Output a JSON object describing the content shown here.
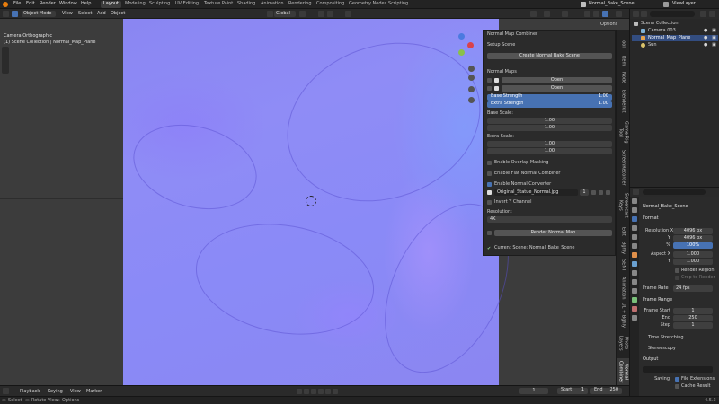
{
  "menu": {
    "items": [
      "File",
      "Edit",
      "Render",
      "Window",
      "Help"
    ],
    "workspaces": [
      "Layout",
      "Modeling",
      "Sculpting",
      "UV Editing",
      "Texture Paint",
      "Shading",
      "Animation",
      "Rendering",
      "Compositing",
      "Geometry Nodes",
      "Scripting"
    ],
    "active_workspace": "Layout",
    "scene": "Normal_Bake_Scene",
    "view_layer": "ViewLayer"
  },
  "editor_header": {
    "mode": "Object Mode",
    "menus": [
      "View",
      "Select",
      "Add",
      "Object"
    ],
    "orientation": "Global",
    "options": "Options"
  },
  "viewport": {
    "camera_label": "Camera Orthographic",
    "collection_label": "(1) Scene Collection | Normal_Map_Plane"
  },
  "panel": {
    "title": "Normal Map Combiner",
    "setup_section": "Setup Scene",
    "create_button": "Create Normal Bake Scene",
    "maps_section": "Normal Maps",
    "open_label": "Open",
    "base_strength_label": "Base Strength",
    "base_strength_value": "1.00",
    "extra_strength_label": "Extra Strength",
    "extra_strength_value": "1.00",
    "base_scale_label": "Base Scale:",
    "base_scale_values": [
      "1.00",
      "1.00"
    ],
    "extra_scale_label": "Extra Scale:",
    "extra_scale_values": [
      "1.00",
      "1.00"
    ],
    "overlap_masking": "Enable Overlap Masking",
    "flat_normal": "Enable Flat Normal Combiner",
    "normal_converter": "Enable Normal Converter",
    "converter_file": "Original_Statue_Normal.jpg",
    "converter_users": "1",
    "invert_y": "Invert Y Channel",
    "resolution_label": "Resolution:",
    "resolution_value": "4K",
    "render_button": "Render Normal Map",
    "current_scene": "Current Scene: Normal_Bake_Scene"
  },
  "side_tabs": [
    "Normal Combiner",
    "Photo Layers",
    "UL + Bghly",
    "Animation",
    "SENT",
    "Bghly",
    "Edit",
    "Screencast Keys",
    "ScreenRecorder",
    "Game Rig Tool",
    "Blenderkit",
    "Node",
    "Item",
    "Tool"
  ],
  "outliner": {
    "root": "Scene Collection",
    "items": [
      "Camera.003",
      "Normal_Map_Plane",
      "Sun"
    ]
  },
  "properties": {
    "scene_name": "Normal_Bake_Scene",
    "format_section": "Format",
    "resolution_x_label": "Resolution X",
    "resolution_x": "4096 px",
    "resolution_y_label": "Y",
    "resolution_y": "4096 px",
    "percent_label": "%",
    "percent": "100%",
    "aspect_x_label": "Aspect X",
    "aspect_x": "1.000",
    "aspect_y_label": "Y",
    "aspect_y": "1.000",
    "render_region": "Render Region",
    "crop_label": "Crop to Render",
    "frame_rate_label": "Frame Rate",
    "frame_rate": "24 fps",
    "frame_range_section": "Frame Range",
    "frame_start_label": "Frame Start",
    "frame_start": "1",
    "end_label": "End",
    "end": "250",
    "step_label": "Step",
    "step": "1",
    "time_stretching": "Time Stretching",
    "stereoscopy": "Stereoscopy",
    "output_section": "Output",
    "saving_label": "Saving",
    "file_extensions": "File Extensions",
    "cache_result": "Cache Result"
  },
  "timeline": {
    "menus": [
      "Playback",
      "Keying",
      "View",
      "Marker"
    ],
    "current_frame": "1",
    "start_label": "Start",
    "start": "1",
    "end_label": "End",
    "end": "250"
  },
  "status": {
    "items": [
      "Select",
      "Rotate View",
      "Options"
    ],
    "version": "4.5.3"
  }
}
